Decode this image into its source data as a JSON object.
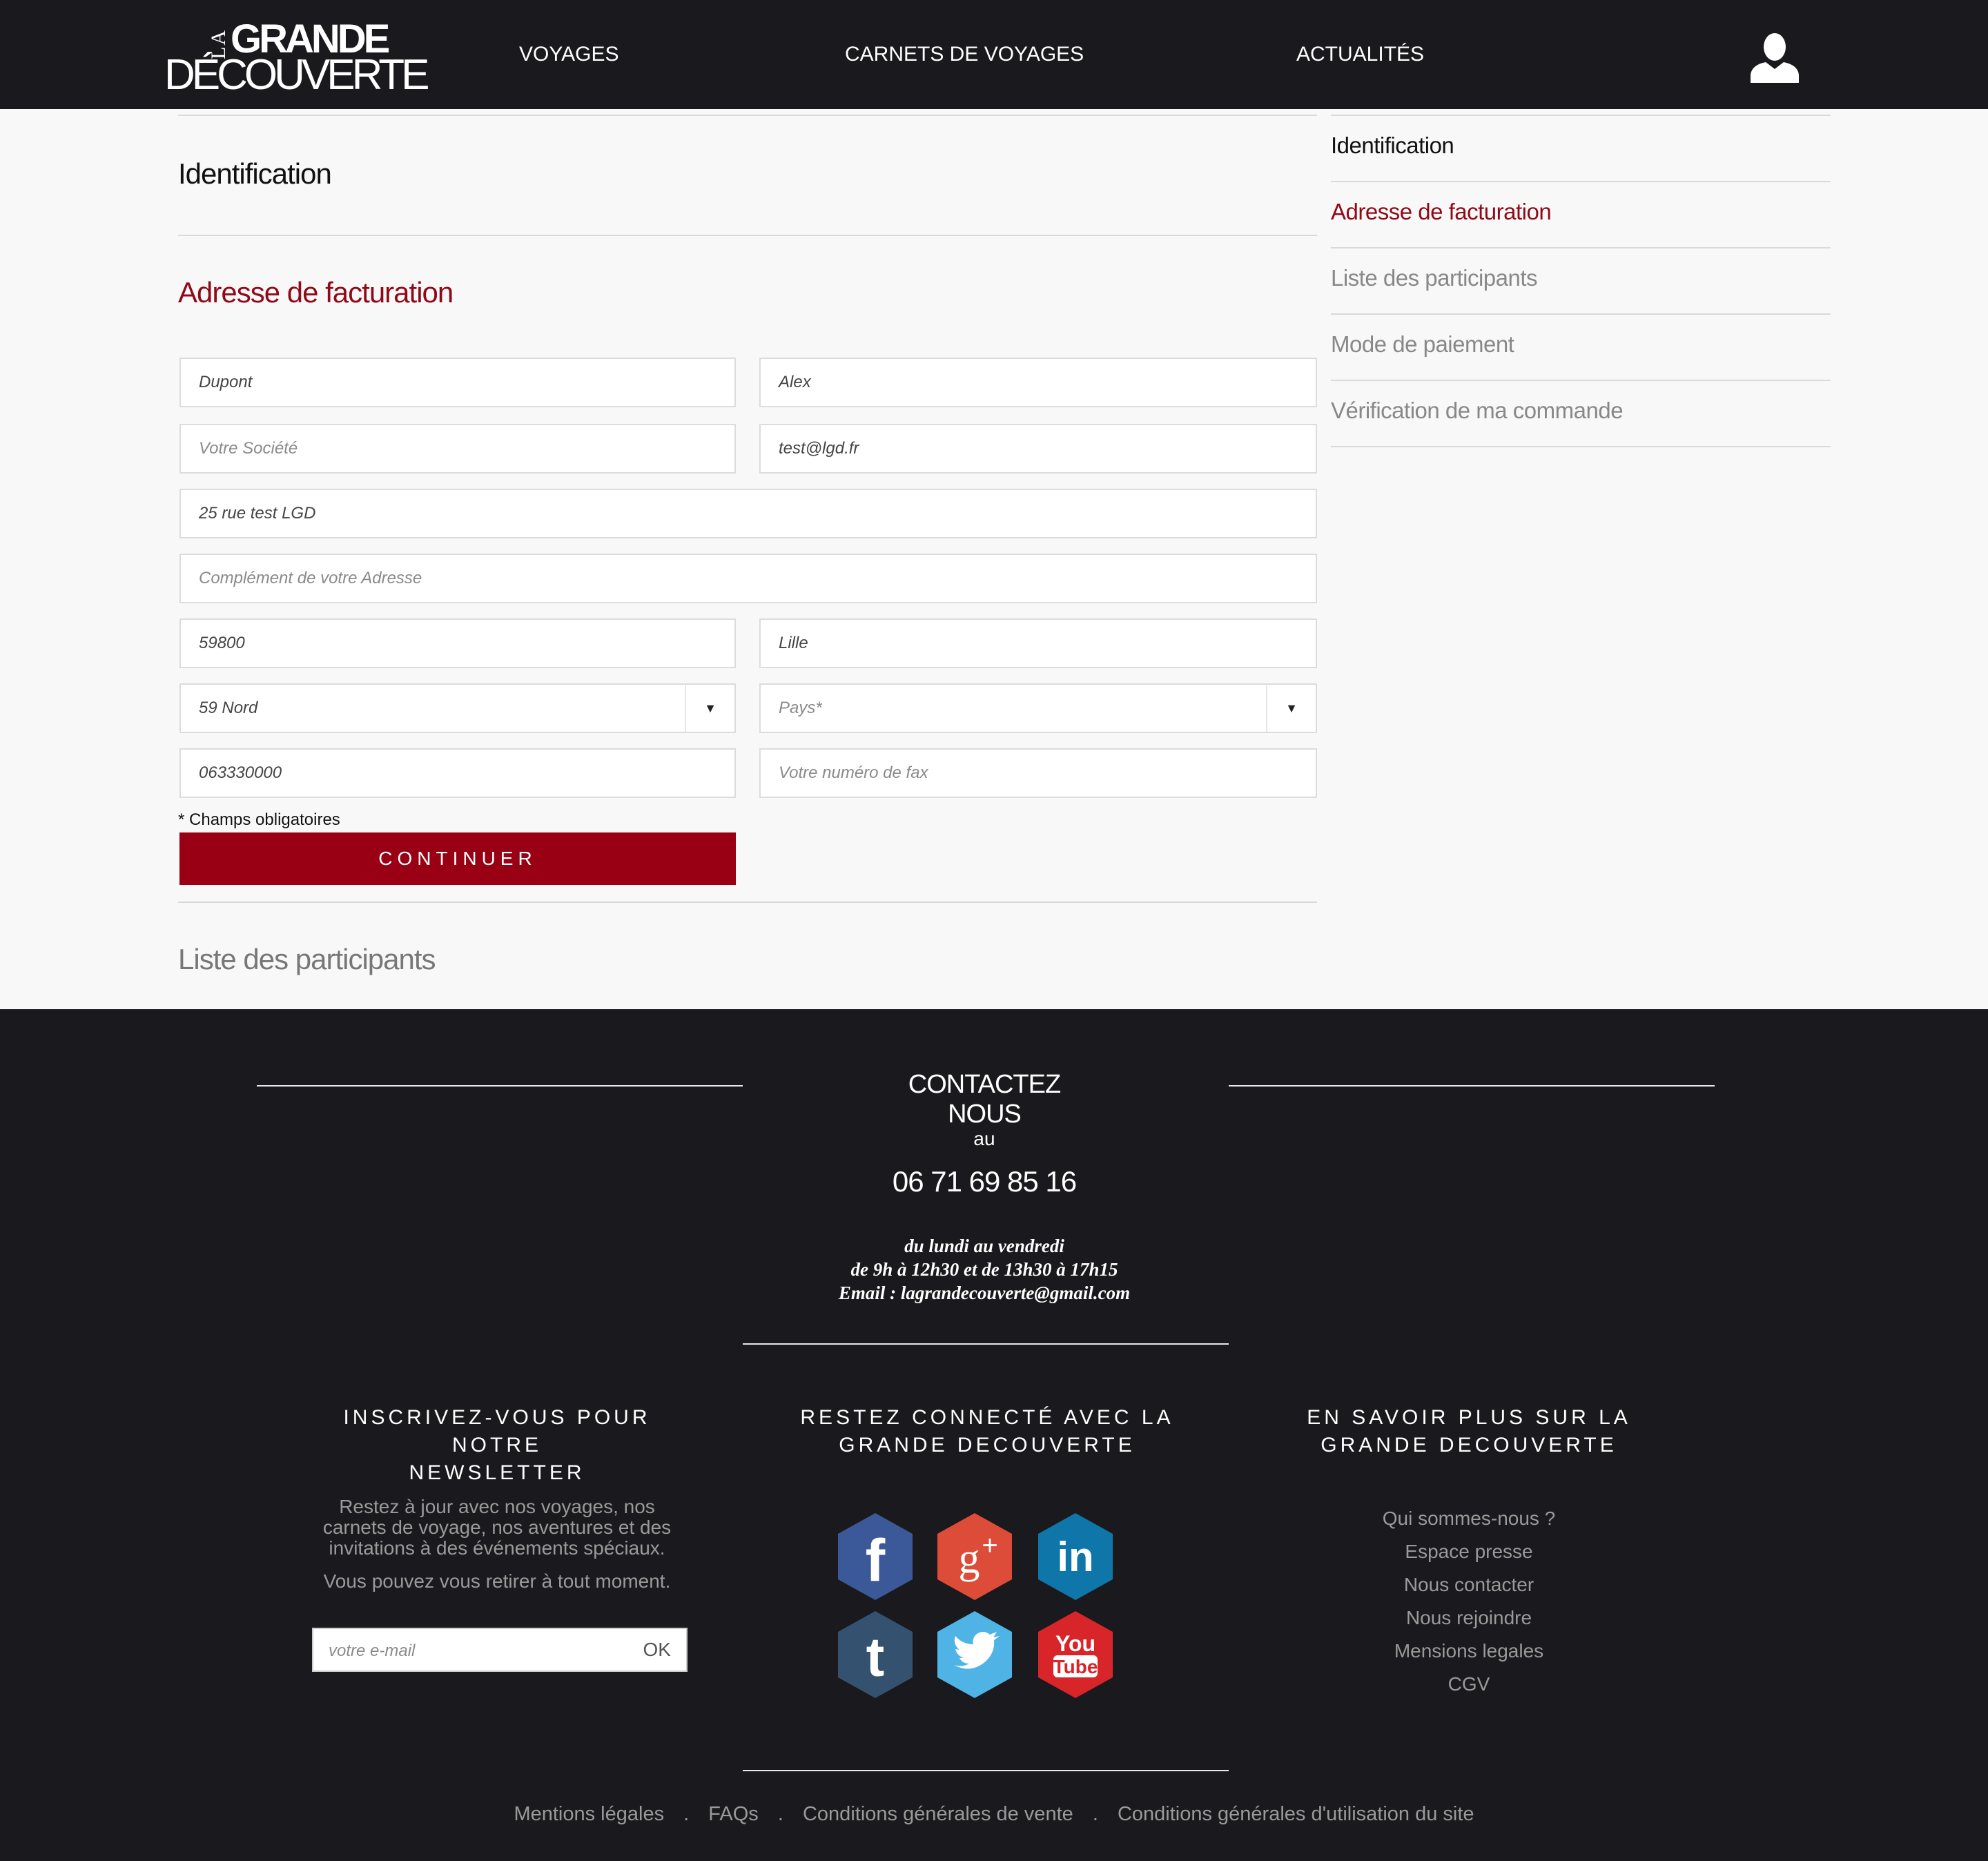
{
  "header": {
    "logo": {
      "la": "LA",
      "grande": "GRANDE",
      "decouverte": "DÉCOUVERTE"
    },
    "nav": [
      "VOYAGES",
      "CARNETS DE VOYAGES",
      "ACTUALITÉS"
    ],
    "user_icon": "user-icon"
  },
  "main": {
    "identification_title": "Identification",
    "billing_title": "Adresse de facturation",
    "fields": {
      "last_name": "Dupont",
      "first_name": "Alex",
      "company_placeholder": "Votre Société",
      "email": "test@lgd.fr",
      "address": "25 rue test LGD",
      "address2_placeholder": "Complément de votre Adresse",
      "zip": "59800",
      "city": "Lille",
      "department": "59 Nord",
      "country_placeholder": "Pays*",
      "phone": "063330000",
      "fax_placeholder": "Votre numéro de fax"
    },
    "required_note": "* Champs obligatoires",
    "continue_label": "CONTINUER",
    "participants_title": "Liste des participants"
  },
  "steps": [
    "Identification",
    "Adresse de facturation",
    "Liste des participants",
    "Mode de paiement",
    "Vérification de ma commande"
  ],
  "footer": {
    "contact_title": "CONTACTEZ NOUS",
    "au": "au",
    "phone": "06 71 69 85 16",
    "hours_line1": "du lundi au vendredi",
    "hours_line2": "de 9h à 12h30 et de 13h30 à 17h15",
    "hours_line3": "Email : lagrandecouverte@gmail.com",
    "newsletter_title_1": "INSCRIVEZ-VOUS POUR NOTRE",
    "newsletter_title_2": "NEWSLETTER",
    "newsletter_text_1": "Restez à jour avec nos voyages, nos",
    "newsletter_text_2": "carnets de voyage, nos aventures et des",
    "newsletter_text_3": "invitations à des événements spéciaux.",
    "newsletter_text_4": "Vous pouvez vous retirer à tout moment.",
    "email_placeholder": "votre e-mail",
    "ok_label": "OK",
    "social_title_1": "RESTEZ CONNECTÉ AVEC LA",
    "social_title_2": "GRANDE DECOUVERTE",
    "social": [
      "facebook",
      "google-plus",
      "linkedin",
      "tumblr",
      "twitter",
      "youtube"
    ],
    "youtube_text_1": "You",
    "youtube_text_2": "Tube",
    "more_title_1": "EN SAVOIR PLUS SUR LA",
    "more_title_2": "GRANDE DECOUVERTE",
    "more_links": [
      "Qui sommes-nous ?",
      "Espace presse",
      "Nous contacter",
      "Nous rejoindre",
      "Mensions legales",
      "CGV"
    ],
    "bottom_links": [
      "Mentions légales",
      "FAQs",
      "Conditions générales de vente",
      "Conditions générales d'utilisation du site"
    ],
    "separator": "."
  },
  "colors": {
    "accent": "#990014",
    "dark": "#1a191d"
  }
}
